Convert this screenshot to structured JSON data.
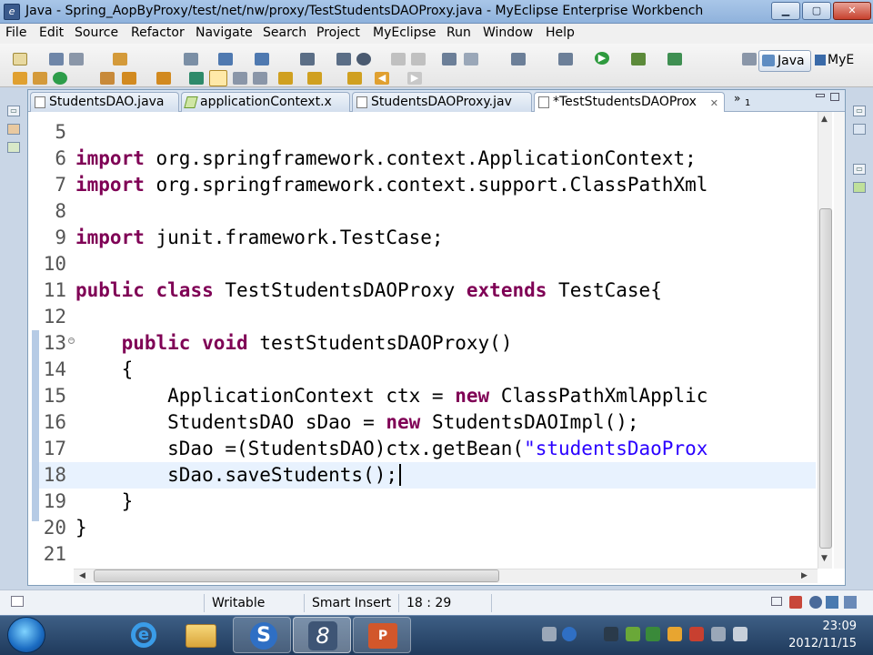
{
  "window": {
    "title": "Java - Spring_AopByProxy/test/net/nw/proxy/TestStudentsDAOProxy.java - MyEclipse Enterprise Workbench",
    "app_icon": "eclipse-icon",
    "controls": {
      "minimize": "▁",
      "maximize": "▢",
      "close": "✕"
    }
  },
  "menubar": [
    "File",
    "Edit",
    "Source",
    "Refactor",
    "Navigate",
    "Search",
    "Project",
    "MyEclipse",
    "Run",
    "Window",
    "Help"
  ],
  "perspectives": {
    "active": "Java",
    "other": "MyE"
  },
  "tabs": [
    {
      "label": "StudentsDAO.java",
      "icon": "java-file-icon",
      "active": false
    },
    {
      "label": "applicationContext.x",
      "icon": "xml-file-icon",
      "active": false
    },
    {
      "label": "StudentsDAOProxy.jav",
      "icon": "java-file-icon",
      "active": false
    },
    {
      "label": "*TestStudentsDAOProx",
      "icon": "java-file-icon",
      "active": true
    }
  ],
  "tab_overflow": {
    "symbol": "»",
    "count": "1"
  },
  "code_lines": [
    {
      "num": "5",
      "parts": []
    },
    {
      "num": "6",
      "parts": [
        {
          "t": "import",
          "c": "kw"
        },
        {
          "t": " org.springframework.context.ApplicationContext;",
          "c": "ident"
        }
      ]
    },
    {
      "num": "7",
      "parts": [
        {
          "t": "import",
          "c": "kw"
        },
        {
          "t": " org.springframework.context.support.ClassPathXml",
          "c": "ident"
        }
      ]
    },
    {
      "num": "8",
      "parts": []
    },
    {
      "num": "9",
      "parts": [
        {
          "t": "import",
          "c": "kw"
        },
        {
          "t": " junit.framework.TestCase;",
          "c": "ident"
        }
      ]
    },
    {
      "num": "10",
      "parts": []
    },
    {
      "num": "11",
      "parts": [
        {
          "t": "public",
          "c": "kw"
        },
        {
          "t": " ",
          "c": "ident"
        },
        {
          "t": "class",
          "c": "kw"
        },
        {
          "t": " TestStudentsDAOProxy ",
          "c": "ident"
        },
        {
          "t": "extends",
          "c": "kw"
        },
        {
          "t": " TestCase{",
          "c": "ident"
        }
      ]
    },
    {
      "num": "12",
      "parts": []
    },
    {
      "num": "13",
      "parts": [
        {
          "t": "    ",
          "c": "ident"
        },
        {
          "t": "public",
          "c": "kw"
        },
        {
          "t": " ",
          "c": "ident"
        },
        {
          "t": "void",
          "c": "kw"
        },
        {
          "t": " testStudentsDAOProxy()",
          "c": "ident"
        }
      ]
    },
    {
      "num": "14",
      "parts": [
        {
          "t": "    {",
          "c": "ident"
        }
      ]
    },
    {
      "num": "15",
      "parts": [
        {
          "t": "        ApplicationContext ctx = ",
          "c": "ident"
        },
        {
          "t": "new",
          "c": "kw"
        },
        {
          "t": " ClassPathXmlApplic",
          "c": "ident"
        }
      ]
    },
    {
      "num": "16",
      "parts": [
        {
          "t": "        StudentsDAO sDao = ",
          "c": "ident"
        },
        {
          "t": "new",
          "c": "kw"
        },
        {
          "t": " StudentsDAOImpl();",
          "c": "ident"
        }
      ]
    },
    {
      "num": "17",
      "parts": [
        {
          "t": "        sDao =(StudentsDAO)ctx.getBean(",
          "c": "ident"
        },
        {
          "t": "\"studentsDaoProx",
          "c": "str"
        }
      ]
    },
    {
      "num": "18",
      "parts": [
        {
          "t": "        sDao.saveStudents();",
          "c": "ident"
        }
      ],
      "current": true
    },
    {
      "num": "19",
      "parts": [
        {
          "t": "    }",
          "c": "ident"
        }
      ]
    },
    {
      "num": "20",
      "parts": [
        {
          "t": "}",
          "c": "ident"
        }
      ]
    },
    {
      "num": "21",
      "parts": []
    }
  ],
  "statusbar": {
    "mode": "Writable",
    "insert": "Smart Insert",
    "position": "18 : 29"
  },
  "taskbar": {
    "apps": [
      "ie-icon",
      "explorer-icon",
      "sogou-icon",
      "myeclipse-icon",
      "powerpoint-icon"
    ],
    "time": "23:09",
    "date": "2012/11/15"
  },
  "colors": {
    "keyword": "#7f0055",
    "string": "#2a00ff",
    "current_line": "#e8f2fe"
  }
}
